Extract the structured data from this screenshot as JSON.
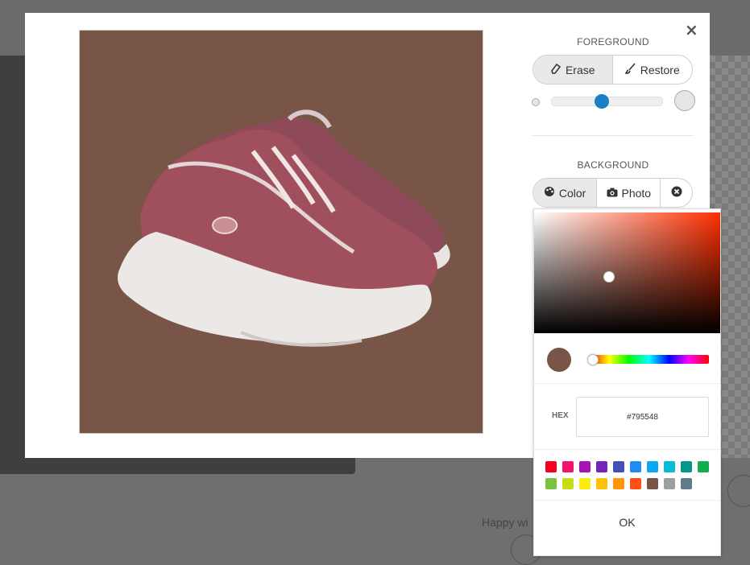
{
  "background_page": {
    "footer_text": "Happy wi"
  },
  "modal": {
    "close_icon": "×",
    "foreground": {
      "title": "FOREGROUND",
      "erase_label": "Erase",
      "restore_label": "Restore",
      "brush_size_fraction": 0.46
    },
    "background": {
      "title": "BACKGROUND",
      "color_label": "Color",
      "photo_label": "Photo"
    },
    "canvas_bg": "#795548"
  },
  "color_picker": {
    "hex_label": "HEX",
    "hex_value": "#795548",
    "current_color": "#795548",
    "hue_fraction": 0.03,
    "ok_label": "OK",
    "swatches": [
      "#f5001f",
      "#f5136b",
      "#a612b3",
      "#7623b8",
      "#4050b5",
      "#1f8cf2",
      "#0aa8f2",
      "#06bcd4",
      "#079688",
      "#13ad4f",
      "#7ac242",
      "#c7dd13",
      "#fdeb09",
      "#fdc108",
      "#fd9507",
      "#fd4f16",
      "#795548",
      "#9e9e9e",
      "#607d8b"
    ]
  }
}
